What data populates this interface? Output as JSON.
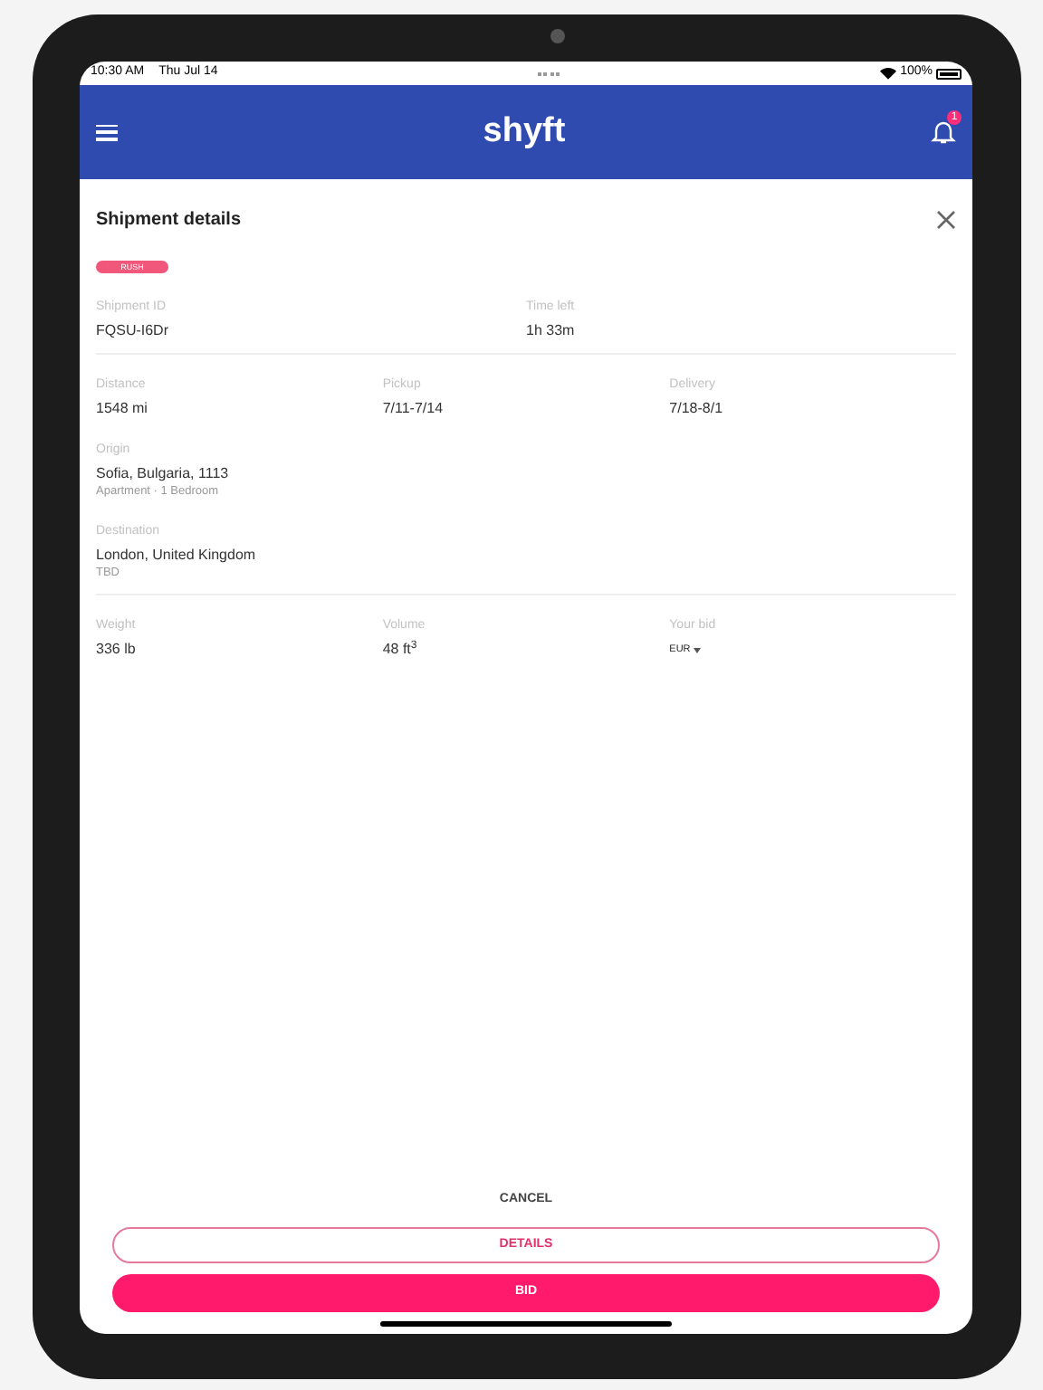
{
  "status_bar": {
    "time": "10:30 AM",
    "date": "Thu Jul 14",
    "battery": "100%"
  },
  "header": {
    "logo": "shyft",
    "notification_count": "1"
  },
  "panel": {
    "title": "Shipment details",
    "badge": "RUSH",
    "rows": [
      {
        "divider": true,
        "fields": [
          {
            "kind": "text",
            "label": "Shipment ID",
            "value": "FQSU-I6Dr"
          },
          {
            "kind": "text",
            "label": "Time left",
            "value": "1h 33m"
          }
        ]
      },
      {
        "divider": false,
        "fields": [
          {
            "kind": "text",
            "label": "Distance",
            "value": "1548 mi"
          },
          {
            "kind": "text",
            "label": "Pickup",
            "value": "7/11-7/14"
          },
          {
            "kind": "text",
            "label": "Delivery",
            "value": "7/18-8/1"
          }
        ]
      },
      {
        "divider": false,
        "fields": [
          {
            "kind": "text",
            "label": "Origin",
            "value": "Sofia, Bulgaria, 1113",
            "note": "Apartment · 1 Bedroom"
          }
        ]
      },
      {
        "divider": true,
        "fields": [
          {
            "kind": "text",
            "label": "Destination",
            "value": "London, United Kingdom",
            "note": "TBD"
          }
        ]
      },
      {
        "divider": false,
        "fields": [
          {
            "kind": "text",
            "label": "Weight",
            "value": "336 lb"
          },
          {
            "kind": "text",
            "label": "Volume",
            "value": "48 ft$^{3}$"
          },
          {
            "kind": "select",
            "label": "Your bid",
            "value": "EUR"
          }
        ]
      }
    ]
  },
  "buttons": [
    {
      "kind": "text",
      "label": "CANCEL"
    },
    {
      "kind": "outline",
      "label": "DETAILS"
    },
    {
      "kind": "filled",
      "label": "BID"
    }
  ]
}
